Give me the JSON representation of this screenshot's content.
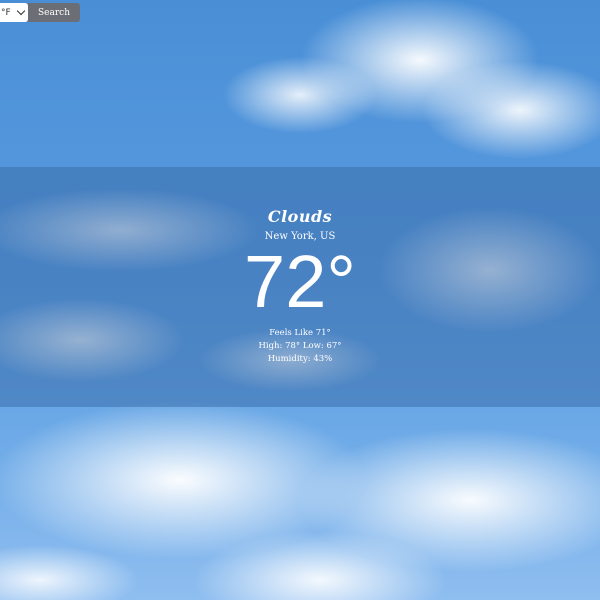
{
  "controls": {
    "unit_select": "°F",
    "search_label": "Search"
  },
  "weather": {
    "condition": "Clouds",
    "location": "New York, US",
    "temperature": "72°",
    "feels_like": "Feels Like 71°",
    "high_low": "High: 78° Low: 67°",
    "humidity": "Humidity: 43%"
  },
  "colors": {
    "overlay": "#3264a0",
    "button": "#6b6f75",
    "sky": "#5a9be0"
  },
  "icons": {
    "unit_dropdown": "chevron-down-icon"
  }
}
